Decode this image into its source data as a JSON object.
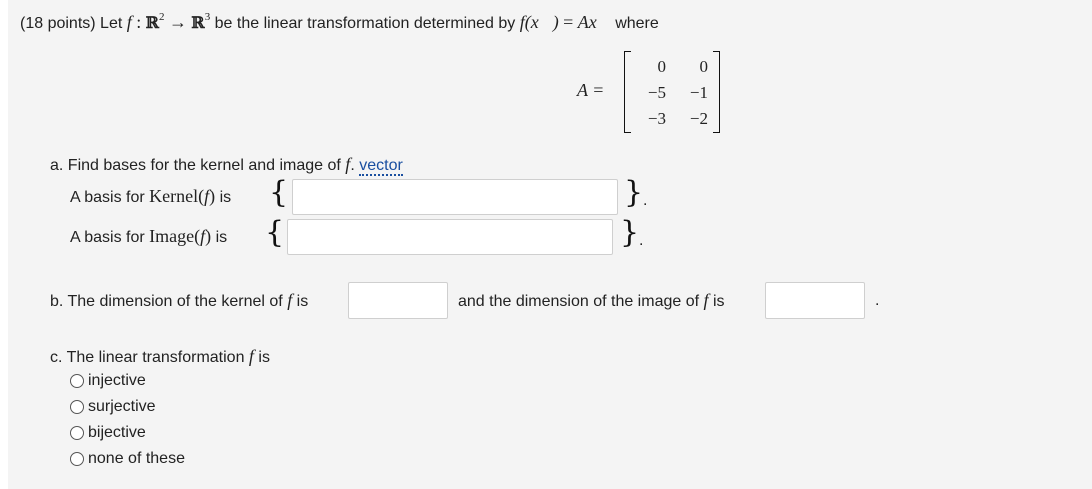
{
  "header": {
    "points": "(18 points)",
    "let": "Let",
    "f": "f",
    "colon": ":",
    "domain": "ℝ",
    "domain_exp": "2",
    "arrow": "→",
    "codomain": "ℝ",
    "codomain_exp": "3",
    "be_text": "be the linear transformation determined by",
    "fx": "f(x⃗)",
    "eq": "=",
    "ax": "Ax⃗",
    "where": "where"
  },
  "matrix": {
    "label": "A =",
    "rows": [
      [
        "0",
        "0"
      ],
      [
        "−5",
        "−1"
      ],
      [
        "−3",
        "−2"
      ]
    ]
  },
  "part_a": {
    "prompt": "a. Find bases for the kernel and image of",
    "f": "f",
    "period": ".",
    "link": "vector",
    "kernel_label": "A basis for",
    "kernel_fn": "Kernel(",
    "kernel_f": "f",
    "kernel_close": ")",
    "is": "is",
    "image_label": "A basis for",
    "image_fn": "Image(",
    "image_f": "f",
    "image_close": ")",
    "open_brace": "{",
    "close_brace": "}",
    "kernel_value": "",
    "image_value": "",
    "dot": "."
  },
  "part_b": {
    "prompt": "b. The dimension of the kernel of",
    "f": "f",
    "is": "is",
    "mid": "and the dimension of the image of",
    "f2": "f",
    "is2": "is",
    "kernel_dim": "",
    "image_dim": "",
    "end": "."
  },
  "part_c": {
    "prompt": "c. The linear transformation",
    "f": "f",
    "is": "is",
    "options": [
      "injective",
      "surjective",
      "bijective",
      "none of these"
    ]
  }
}
